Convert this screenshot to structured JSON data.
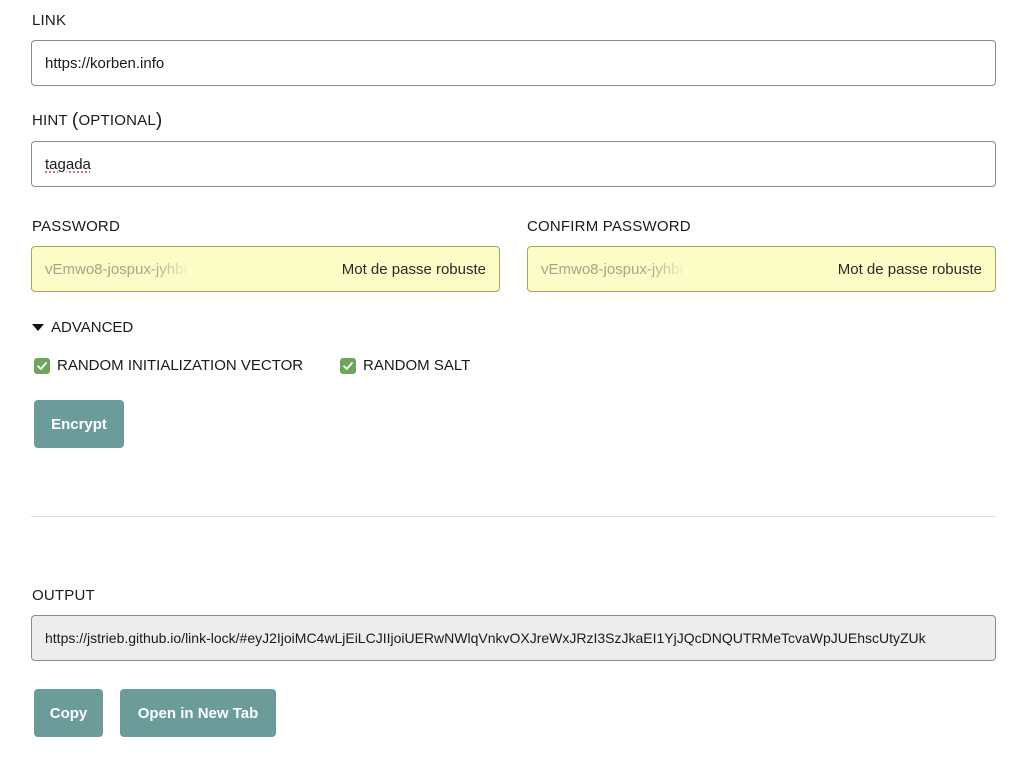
{
  "link": {
    "label": "LINK",
    "value": "https://korben.info"
  },
  "hint": {
    "label": "HINT",
    "paren_open": "(",
    "optional": "OPTIONAL",
    "paren_close": ")",
    "value": "tagada"
  },
  "password": {
    "label": "PASSWORD",
    "value": "vEmwo8-jospux-jyhbi",
    "strength": "Mot de passe robuste"
  },
  "confirm_password": {
    "label": "CONFIRM PASSWORD",
    "value": "vEmwo8-jospux-jyhbi",
    "strength": "Mot de passe robuste"
  },
  "advanced": {
    "label": "ADVANCED",
    "expanded": true,
    "options": [
      {
        "label": "RANDOM INITIALIZATION VECTOR",
        "checked": true
      },
      {
        "label": "RANDOM SALT",
        "checked": true
      }
    ]
  },
  "encrypt_button": "Encrypt",
  "output": {
    "label": "OUTPUT",
    "value": "https://jstrieb.github.io/link-lock/#eyJ2IjoiMC4wLjEiLCJIIjoiUERwNWlqVnkvOXJreWxJRzI3SzJkaEI1YjJQcDNQUTRMeTcvaWpJUEhscUtyZUk"
  },
  "copy_button": "Copy",
  "open_tab_button": "Open in New Tab",
  "colors": {
    "button": "#6b9c9a",
    "password_bg": "#fbfcc6",
    "checkbox": "#6fa55a",
    "output_bg": "#ededed"
  },
  "icons": {
    "advanced_toggle": "caret-down-icon",
    "checkbox": "check-icon"
  }
}
